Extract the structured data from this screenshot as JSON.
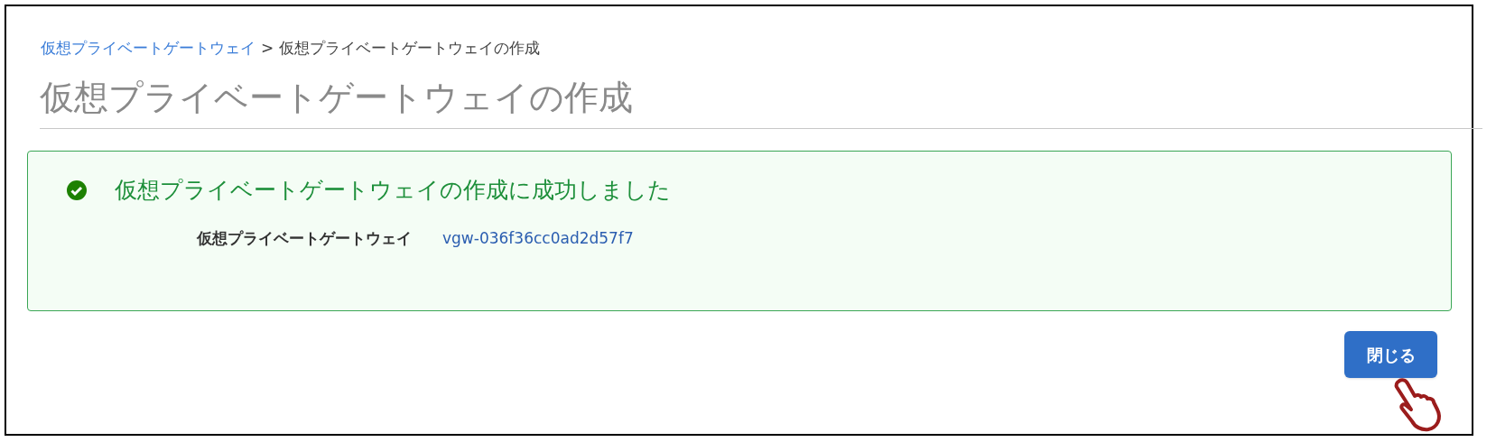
{
  "breadcrumb": {
    "link": "仮想プライベートゲートウェイ",
    "separator": ">",
    "current": "仮想プライベートゲートウェイの作成"
  },
  "title": "仮想プライベートゲートウェイの作成",
  "alert": {
    "kind": "success",
    "message": "仮想プライベートゲートウェイの作成に成功しました",
    "label": "仮想プライベートゲートウェイ",
    "value": "vgw-036f36cc0ad2d57f7"
  },
  "buttons": [
    {
      "label": "閉じる"
    }
  ]
}
